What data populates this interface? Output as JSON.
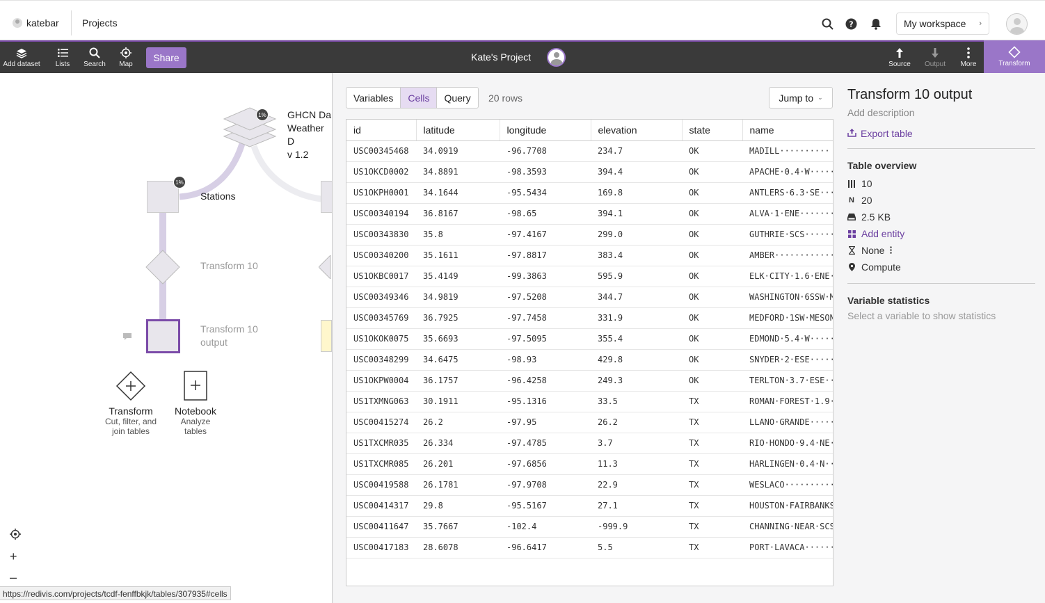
{
  "topnav": {
    "username": "katebar",
    "projects_label": "Projects",
    "workspace_label": "My workspace",
    "icons": [
      "search-icon",
      "help-icon",
      "bell-icon"
    ]
  },
  "toolbar": {
    "add_dataset": "Add dataset",
    "lists": "Lists",
    "search": "Search",
    "map": "Map",
    "share": "Share",
    "project_title": "Kate's Project",
    "source": "Source",
    "output": "Output",
    "more": "More",
    "transform": "Transform"
  },
  "canvas": {
    "dataset_label_lines": [
      "GHCN Da",
      "Weather D",
      "v 1.2"
    ],
    "dataset_badge": "1%",
    "stations_label": "Stations",
    "stations_badge": "1%",
    "transform_label": "Transform 10",
    "output_label_lines": [
      "Transform 10",
      "output"
    ],
    "add_transform": {
      "title": "Transform",
      "sub_lines": [
        "Cut, filter, and",
        "join tables"
      ]
    },
    "add_notebook": {
      "title": "Notebook",
      "sub_lines": [
        "Analyze",
        "tables"
      ]
    }
  },
  "status_url": "https://redivis.com/projects/tcdf-fenffbkjk/tables/307935#cells",
  "panel": {
    "tabs": [
      {
        "label": "Variables",
        "active": false
      },
      {
        "label": "Cells",
        "active": true
      },
      {
        "label": "Query",
        "active": false
      }
    ],
    "rows_count": "20 rows",
    "jump_to": "Jump to",
    "columns": [
      "id",
      "latitude",
      "longitude",
      "elevation",
      "state",
      "name"
    ],
    "rows": [
      [
        "USC00345468",
        "34.0919",
        "-96.7708",
        "234.7",
        "OK",
        "MADILL··········"
      ],
      [
        "US1OKCD0002",
        "34.8891",
        "-98.3593",
        "394.4",
        "OK",
        "APACHE·0.4·W·····"
      ],
      [
        "US1OKPH0001",
        "34.1644",
        "-95.5434",
        "169.8",
        "OK",
        "ANTLERS·6.3·SE···"
      ],
      [
        "USC00340194",
        "36.8167",
        "-98.65",
        "394.1",
        "OK",
        "ALVA·1·ENE·······"
      ],
      [
        "USC00343830",
        "35.8",
        "-97.4167",
        "299.0",
        "OK",
        "GUTHRIE·SCS······"
      ],
      [
        "USC00340200",
        "35.1611",
        "-97.8817",
        "383.4",
        "OK",
        "AMBER············"
      ],
      [
        "US1OKBC0017",
        "35.4149",
        "-99.3863",
        "595.9",
        "OK",
        "ELK·CITY·1.6·ENE·"
      ],
      [
        "USC00349346",
        "34.9819",
        "-97.5208",
        "344.7",
        "OK",
        "WASHINGTON·6SSW·M"
      ],
      [
        "USC00345769",
        "36.7925",
        "-97.7458",
        "331.9",
        "OK",
        "MEDFORD·1SW·MESON"
      ],
      [
        "US1OKOK0075",
        "35.6693",
        "-97.5095",
        "355.4",
        "OK",
        "EDMOND·5.4·W·····"
      ],
      [
        "USC00348299",
        "34.6475",
        "-98.93",
        "429.8",
        "OK",
        "SNYDER·2·ESE·····"
      ],
      [
        "US1OKPW0004",
        "36.1757",
        "-96.4258",
        "249.3",
        "OK",
        "TERLTON·3.7·ESE··"
      ],
      [
        "US1TXMNG063",
        "30.1911",
        "-95.1316",
        "33.5",
        "TX",
        "ROMAN·FOREST·1.9·"
      ],
      [
        "USC00415274",
        "26.2",
        "-97.95",
        "26.2",
        "TX",
        "LLANO·GRANDE·····"
      ],
      [
        "US1TXCMR035",
        "26.334",
        "-97.4785",
        "3.7",
        "TX",
        "RIO·HONDO·9.4·NE·"
      ],
      [
        "US1TXCMR085",
        "26.201",
        "-97.6856",
        "11.3",
        "TX",
        "HARLINGEN·0.4·N··"
      ],
      [
        "USC00419588",
        "26.1781",
        "-97.9708",
        "22.9",
        "TX",
        "WESLACO··········"
      ],
      [
        "USC00414317",
        "29.8",
        "-95.5167",
        "27.1",
        "TX",
        "HOUSTON·FAIRBANKS"
      ],
      [
        "USC00411647",
        "35.7667",
        "-102.4",
        "-999.9",
        "TX",
        "CHANNING·NEAR·SCS"
      ],
      [
        "USC00417183",
        "28.6078",
        "-96.6417",
        "5.5",
        "TX",
        "PORT·LAVACA······"
      ]
    ]
  },
  "side": {
    "title": "Transform 10 output",
    "add_description": "Add description",
    "export_table": "Export table",
    "overview_heading": "Table overview",
    "variables_count": "10",
    "rows_count": "20",
    "size": "2.5 KB",
    "add_entity": "Add entity",
    "temporal": "None",
    "compute": "Compute",
    "stats_heading": "Variable statistics",
    "stats_placeholder": "Select a variable to show statistics"
  },
  "colors": {
    "accent": "#7b4ba8",
    "accent_light": "#9a76c8",
    "toolbar_bg": "#3a3a3a"
  }
}
